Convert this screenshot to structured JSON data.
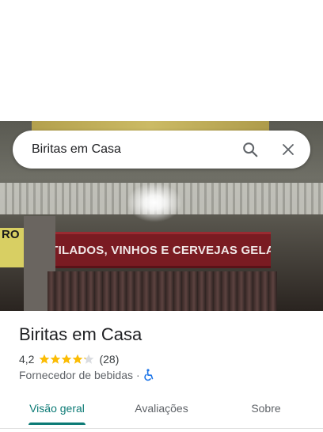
{
  "search": {
    "query": "Biritas em Casa"
  },
  "hero": {
    "sign_text": "DESTILADOS, VINHOS E CERVEJAS GELADAS",
    "left_sign_text": "RO"
  },
  "place": {
    "name": "Biritas em Casa",
    "rating": "4,2",
    "rating_value": 4.2,
    "review_count": "(28)",
    "category": "Fornecedor de bebidas",
    "separator": "·",
    "accessibility_icon": "wheelchair-icon"
  },
  "tabs": [
    {
      "label": "Visão geral",
      "active": true
    },
    {
      "label": "Avaliações",
      "active": false
    },
    {
      "label": "Sobre",
      "active": false
    }
  ],
  "colors": {
    "accent": "#0b7a75",
    "star": "#fbbc04",
    "star_empty": "#dadce0",
    "accessibility": "#1a73e8"
  }
}
